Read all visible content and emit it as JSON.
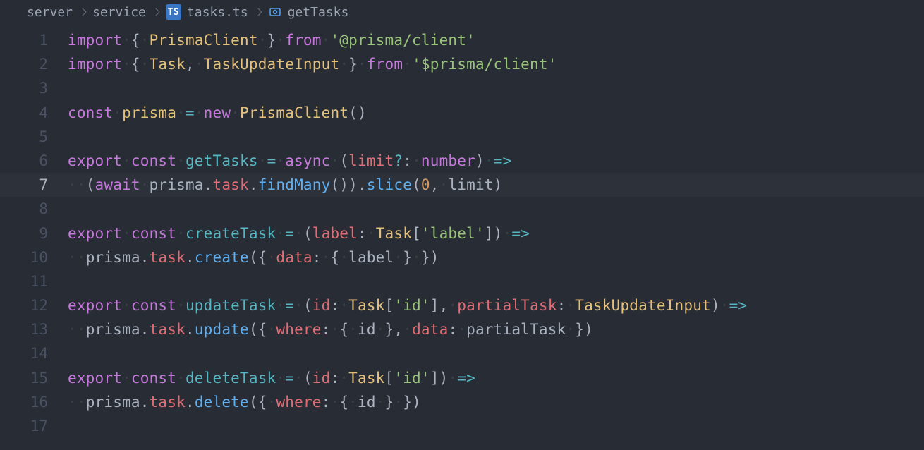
{
  "breadcrumb": {
    "seg1": "server",
    "seg2": "service",
    "file_badge": "TS",
    "file": "tasks.ts",
    "symbol": "getTasks"
  },
  "editor": {
    "highlighted_line": 7,
    "line_numbers": [
      "1",
      "2",
      "3",
      "4",
      "5",
      "6",
      "7",
      "8",
      "9",
      "10",
      "11",
      "12",
      "13",
      "14",
      "15",
      "16",
      "17"
    ],
    "code_plain": [
      "import { PrismaClient } from '@prisma/client'",
      "import { Task, TaskUpdateInput } from '$prisma/client'",
      "",
      "const prisma = new PrismaClient()",
      "",
      "export const getTasks = async (limit?: number) =>",
      "  (await prisma.task.findMany()).slice(0, limit)",
      "",
      "export const createTask = (label: Task['label']) =>",
      "  prisma.task.create({ data: { label } })",
      "",
      "export const updateTask = (id: Task['id'], partialTask: TaskUpdateInput) =>",
      "  prisma.task.update({ where: { id }, data: partialTask })",
      "",
      "export const deleteTask = (id: Task['id']) =>",
      "  prisma.task.delete({ where: { id } })",
      ""
    ],
    "tokens": [
      [
        [
          "k-import",
          "import"
        ],
        [
          "t-ws",
          " "
        ],
        [
          "t-punc",
          "{"
        ],
        [
          "t-ws",
          " "
        ],
        [
          "t-class",
          "PrismaClient"
        ],
        [
          "t-ws",
          " "
        ],
        [
          "t-punc",
          "}"
        ],
        [
          "t-ws",
          " "
        ],
        [
          "k-from",
          "from"
        ],
        [
          "t-ws",
          " "
        ],
        [
          "t-str",
          "'@prisma/client'"
        ]
      ],
      [
        [
          "k-import",
          "import"
        ],
        [
          "t-ws",
          " "
        ],
        [
          "t-punc",
          "{"
        ],
        [
          "t-ws",
          " "
        ],
        [
          "t-class",
          "Task"
        ],
        [
          "t-punc",
          ","
        ],
        [
          "t-ws",
          " "
        ],
        [
          "t-class",
          "TaskUpdateInput"
        ],
        [
          "t-ws",
          " "
        ],
        [
          "t-punc",
          "}"
        ],
        [
          "t-ws",
          " "
        ],
        [
          "k-from",
          "from"
        ],
        [
          "t-ws",
          " "
        ],
        [
          "t-str",
          "'$prisma/client'"
        ]
      ],
      [],
      [
        [
          "kw2",
          "const"
        ],
        [
          "t-ws",
          " "
        ],
        [
          "t-class",
          "prisma"
        ],
        [
          "t-ws",
          " "
        ],
        [
          "t-op",
          "="
        ],
        [
          "t-ws",
          " "
        ],
        [
          "k-new",
          "new"
        ],
        [
          "t-ws",
          " "
        ],
        [
          "t-class",
          "PrismaClient"
        ],
        [
          "t-punc",
          "()"
        ]
      ],
      [],
      [
        [
          "k-export",
          "export"
        ],
        [
          "t-ws",
          " "
        ],
        [
          "kw2",
          "const"
        ],
        [
          "t-ws",
          " "
        ],
        [
          "t-func",
          "getTasks"
        ],
        [
          "t-ws",
          " "
        ],
        [
          "t-op",
          "="
        ],
        [
          "t-ws",
          " "
        ],
        [
          "k-async",
          "async"
        ],
        [
          "t-ws",
          " "
        ],
        [
          "t-punc",
          "("
        ],
        [
          "t-param",
          "limit"
        ],
        [
          "t-op",
          "?"
        ],
        [
          "t-punc",
          ":"
        ],
        [
          "t-ws",
          " "
        ],
        [
          "t-type",
          "number"
        ],
        [
          "t-punc",
          ")"
        ],
        [
          "t-ws",
          " "
        ],
        [
          "t-op",
          "=>"
        ]
      ],
      [
        [
          "t-ws",
          "  "
        ],
        [
          "t-punc",
          "("
        ],
        [
          "k-await",
          "await"
        ],
        [
          "t-ws",
          " "
        ],
        [
          "t-ident",
          "prisma"
        ],
        [
          "t-dot",
          "."
        ],
        [
          "t-prop",
          "task"
        ],
        [
          "t-dot",
          "."
        ],
        [
          "t-call",
          "findMany"
        ],
        [
          "t-punc",
          "()"
        ],
        [
          "t-punc",
          ")"
        ],
        [
          "t-dot",
          "."
        ],
        [
          "t-call",
          "slice"
        ],
        [
          "t-punc",
          "("
        ],
        [
          "t-num",
          "0"
        ],
        [
          "t-punc",
          ","
        ],
        [
          "t-ws",
          " "
        ],
        [
          "t-ident",
          "limit"
        ],
        [
          "t-punc",
          ")"
        ]
      ],
      [],
      [
        [
          "k-export",
          "export"
        ],
        [
          "t-ws",
          " "
        ],
        [
          "kw2",
          "const"
        ],
        [
          "t-ws",
          " "
        ],
        [
          "t-func",
          "createTask"
        ],
        [
          "t-ws",
          " "
        ],
        [
          "t-op",
          "="
        ],
        [
          "t-ws",
          " "
        ],
        [
          "t-punc",
          "("
        ],
        [
          "t-param",
          "label"
        ],
        [
          "t-punc",
          ":"
        ],
        [
          "t-ws",
          " "
        ],
        [
          "t-class",
          "Task"
        ],
        [
          "t-punc",
          "["
        ],
        [
          "t-str",
          "'label'"
        ],
        [
          "t-punc",
          "]"
        ],
        [
          "t-punc",
          ")"
        ],
        [
          "t-ws",
          " "
        ],
        [
          "t-op",
          "=>"
        ]
      ],
      [
        [
          "t-ws",
          "  "
        ],
        [
          "t-ident",
          "prisma"
        ],
        [
          "t-dot",
          "."
        ],
        [
          "t-prop",
          "task"
        ],
        [
          "t-dot",
          "."
        ],
        [
          "t-call",
          "create"
        ],
        [
          "t-punc",
          "({"
        ],
        [
          "t-ws",
          " "
        ],
        [
          "t-prop",
          "data"
        ],
        [
          "t-punc",
          ":"
        ],
        [
          "t-ws",
          " "
        ],
        [
          "t-punc",
          "{"
        ],
        [
          "t-ws",
          " "
        ],
        [
          "t-ident",
          "label"
        ],
        [
          "t-ws",
          " "
        ],
        [
          "t-punc",
          "}"
        ],
        [
          "t-ws",
          " "
        ],
        [
          "t-punc",
          "})"
        ]
      ],
      [],
      [
        [
          "k-export",
          "export"
        ],
        [
          "t-ws",
          " "
        ],
        [
          "kw2",
          "const"
        ],
        [
          "t-ws",
          " "
        ],
        [
          "t-func",
          "updateTask"
        ],
        [
          "t-ws",
          " "
        ],
        [
          "t-op",
          "="
        ],
        [
          "t-ws",
          " "
        ],
        [
          "t-punc",
          "("
        ],
        [
          "t-param",
          "id"
        ],
        [
          "t-punc",
          ":"
        ],
        [
          "t-ws",
          " "
        ],
        [
          "t-class",
          "Task"
        ],
        [
          "t-punc",
          "["
        ],
        [
          "t-str",
          "'id'"
        ],
        [
          "t-punc",
          "]"
        ],
        [
          "t-punc",
          ","
        ],
        [
          "t-ws",
          " "
        ],
        [
          "t-param",
          "partialTask"
        ],
        [
          "t-punc",
          ":"
        ],
        [
          "t-ws",
          " "
        ],
        [
          "t-class",
          "TaskUpdateInput"
        ],
        [
          "t-punc",
          ")"
        ],
        [
          "t-ws",
          " "
        ],
        [
          "t-op",
          "=>"
        ]
      ],
      [
        [
          "t-ws",
          "  "
        ],
        [
          "t-ident",
          "prisma"
        ],
        [
          "t-dot",
          "."
        ],
        [
          "t-prop",
          "task"
        ],
        [
          "t-dot",
          "."
        ],
        [
          "t-call",
          "update"
        ],
        [
          "t-punc",
          "({"
        ],
        [
          "t-ws",
          " "
        ],
        [
          "t-prop",
          "where"
        ],
        [
          "t-punc",
          ":"
        ],
        [
          "t-ws",
          " "
        ],
        [
          "t-punc",
          "{"
        ],
        [
          "t-ws",
          " "
        ],
        [
          "t-ident",
          "id"
        ],
        [
          "t-ws",
          " "
        ],
        [
          "t-punc",
          "}"
        ],
        [
          "t-punc",
          ","
        ],
        [
          "t-ws",
          " "
        ],
        [
          "t-prop",
          "data"
        ],
        [
          "t-punc",
          ":"
        ],
        [
          "t-ws",
          " "
        ],
        [
          "t-ident",
          "partialTask"
        ],
        [
          "t-ws",
          " "
        ],
        [
          "t-punc",
          "})"
        ]
      ],
      [],
      [
        [
          "k-export",
          "export"
        ],
        [
          "t-ws",
          " "
        ],
        [
          "kw2",
          "const"
        ],
        [
          "t-ws",
          " "
        ],
        [
          "t-func",
          "deleteTask"
        ],
        [
          "t-ws",
          " "
        ],
        [
          "t-op",
          "="
        ],
        [
          "t-ws",
          " "
        ],
        [
          "t-punc",
          "("
        ],
        [
          "t-param",
          "id"
        ],
        [
          "t-punc",
          ":"
        ],
        [
          "t-ws",
          " "
        ],
        [
          "t-class",
          "Task"
        ],
        [
          "t-punc",
          "["
        ],
        [
          "t-str",
          "'id'"
        ],
        [
          "t-punc",
          "]"
        ],
        [
          "t-punc",
          ")"
        ],
        [
          "t-ws",
          " "
        ],
        [
          "t-op",
          "=>"
        ]
      ],
      [
        [
          "t-ws",
          "  "
        ],
        [
          "t-ident",
          "prisma"
        ],
        [
          "t-dot",
          "."
        ],
        [
          "t-prop",
          "task"
        ],
        [
          "t-dot",
          "."
        ],
        [
          "t-call",
          "delete"
        ],
        [
          "t-punc",
          "({"
        ],
        [
          "t-ws",
          " "
        ],
        [
          "t-prop",
          "where"
        ],
        [
          "t-punc",
          ":"
        ],
        [
          "t-ws",
          " "
        ],
        [
          "t-punc",
          "{"
        ],
        [
          "t-ws",
          " "
        ],
        [
          "t-ident",
          "id"
        ],
        [
          "t-ws",
          " "
        ],
        [
          "t-punc",
          "}"
        ],
        [
          "t-ws",
          " "
        ],
        [
          "t-punc",
          "})"
        ]
      ],
      []
    ]
  }
}
